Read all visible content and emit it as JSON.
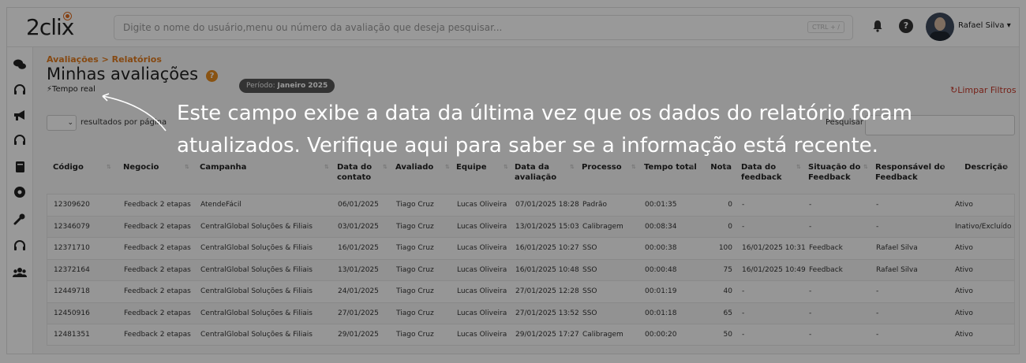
{
  "header": {
    "logo": "2clix",
    "search_placeholder": "Digite o nome do usuário,menu ou número da avaliação que deseja pesquisar...",
    "shortcut": "CTRL + /",
    "help_label": "?",
    "user_name": "Rafael Silva",
    "user_caret": "▾"
  },
  "sidebar": {
    "icons": [
      "chat-icon",
      "headset-icon",
      "megaphone-icon",
      "headset-icon",
      "book-icon",
      "gauge-icon",
      "wrench-icon",
      "headset-icon",
      "users-icon"
    ]
  },
  "page": {
    "breadcrumb": "Avaliações  >  Relatórios",
    "title": "Minhas avaliações",
    "help_label": "?",
    "period_label": "Período:",
    "period_value": "Janeiro 2025",
    "realtime": "Tempo real",
    "clear_filters": "Limpar Filtros",
    "per_page_label": "resultados por página",
    "search_label": "Pesquisar"
  },
  "table": {
    "columns": [
      "Código",
      "Negocio",
      "Campanha",
      "Data do contato",
      "Avaliado",
      "Equipe",
      "Data da avaliação",
      "Processo",
      "Tempo total",
      "Nota",
      "Data do feedback",
      "Situação do Feedback",
      "Responsável do Feedback",
      "Descrição"
    ],
    "rows": [
      [
        "12309620",
        "Feedback 2 etapas",
        "AtendeFácil",
        "06/01/2025",
        "Tiago Cruz",
        "Lucas Oliveira",
        "07/01/2025 18:28",
        "Padrão",
        "00:01:35",
        "0",
        "-",
        "-",
        "-",
        "Ativo"
      ],
      [
        "12346079",
        "Feedback 2 etapas",
        "CentralGlobal Soluções & Filiais",
        "03/01/2025",
        "Tiago Cruz",
        "Lucas Oliveira",
        "13/01/2025 15:03",
        "Calibragem",
        "00:08:34",
        "0",
        "-",
        "-",
        "-",
        "Inativo/Excluído"
      ],
      [
        "12371710",
        "Feedback 2 etapas",
        "CentralGlobal Soluções & Filiais",
        "16/01/2025",
        "Tiago Cruz",
        "Lucas Oliveira",
        "16/01/2025 10:27",
        "SSO",
        "00:00:38",
        "100",
        "16/01/2025 10:31",
        "Feedback",
        "Rafael Silva",
        "Ativo"
      ],
      [
        "12372164",
        "Feedback 2 etapas",
        "CentralGlobal Soluções & Filiais",
        "13/01/2025",
        "Tiago Cruz",
        "Lucas Oliveira",
        "16/01/2025 10:48",
        "SSO",
        "00:00:48",
        "75",
        "16/01/2025 10:49",
        "Feedback",
        "Rafael Silva",
        "Ativo"
      ],
      [
        "12449718",
        "Feedback 2 etapas",
        "CentralGlobal Soluções & Filiais",
        "24/01/2025",
        "Tiago Cruz",
        "Lucas Oliveira",
        "27/01/2025 12:28",
        "SSO",
        "00:01:19",
        "40",
        "-",
        "-",
        "-",
        "Ativo"
      ],
      [
        "12450916",
        "Feedback 2 etapas",
        "CentralGlobal Soluções & Filiais",
        "27/01/2025",
        "Tiago Cruz",
        "Lucas Oliveira",
        "27/01/2025 13:52",
        "SSO",
        "00:01:18",
        "65",
        "-",
        "-",
        "-",
        "Ativo"
      ],
      [
        "12481351",
        "Feedback 2 etapas",
        "CentralGlobal Soluções & Filiais",
        "29/01/2025",
        "Tiago Cruz",
        "Lucas Oliveira",
        "29/01/2025 17:27",
        "Calibragem",
        "00:00:20",
        "50",
        "-",
        "-",
        "-",
        "Ativo"
      ]
    ]
  },
  "tooltip": {
    "text": "Este campo exibe a data da última vez que os dados do relatório foram atualizados. Verifique aqui para saber se a informação está recente."
  },
  "colors": {
    "accent": "#e07b1e",
    "danger": "#c53a2b",
    "overlay": "rgba(0,0,0,0.40)"
  }
}
